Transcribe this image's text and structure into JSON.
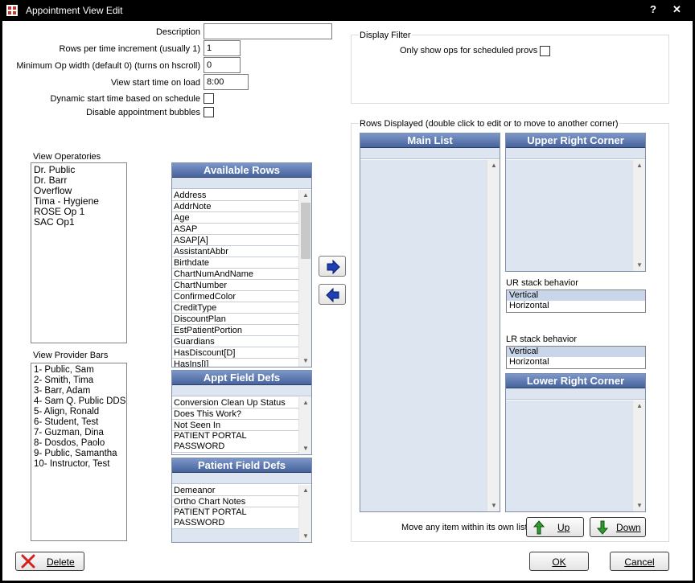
{
  "window": {
    "title": "Appointment View Edit",
    "help_label": "?",
    "close_label": "✕"
  },
  "form": {
    "description_label": "Description",
    "description_value": "",
    "rows_per_increment_label": "Rows per time increment (usually 1)",
    "rows_per_increment_value": "1",
    "min_op_width_label": "Minimum Op width (default 0) (turns on hscroll)",
    "min_op_width_value": "0",
    "view_start_time_label": "View start time on load",
    "view_start_time_value": "8:00",
    "dynamic_start_label": "Dynamic start time based on schedule",
    "disable_bubbles_label": "Disable appointment bubbles"
  },
  "display_filter": {
    "group_label": "Display Filter",
    "only_show_ops_label": "Only show ops for scheduled provs"
  },
  "operatories": {
    "label": "View Operatories",
    "items": [
      "Dr. Public",
      "Dr. Barr",
      "Overflow",
      "Tima - Hygiene",
      "ROSE Op 1",
      "SAC Op1"
    ]
  },
  "provider_bars": {
    "label": "View Provider Bars",
    "items": [
      "1- Public, Sam",
      "2- Smith, Tima",
      "3- Barr, Adam",
      "4- Sam Q. Public DDS",
      "5- Align, Ronald",
      "6- Student, Test",
      "7- Guzman, Dina",
      "8- Dosdos, Paolo",
      "9- Public, Samantha",
      "10- Instructor, Test"
    ]
  },
  "available_rows": {
    "title": "Available Rows",
    "items": [
      "Address",
      "AddrNote",
      "Age",
      "ASAP",
      "ASAP[A]",
      "AssistantAbbr",
      "Birthdate",
      "ChartNumAndName",
      "ChartNumber",
      "ConfirmedColor",
      "CreditType",
      "DiscountPlan",
      "EstPatientPortion",
      "Guardians",
      "HasDiscount[D]",
      "HasIns[I]"
    ]
  },
  "appt_field_defs": {
    "title": "Appt Field Defs",
    "items": [
      "Conversion Clean Up Status",
      "Does This Work?",
      "Not Seen In",
      "PATIENT PORTAL PASSWORD"
    ]
  },
  "patient_field_defs": {
    "title": "Patient Field Defs",
    "items": [
      "Demeanor",
      "Ortho Chart Notes",
      "PATIENT PORTAL PASSWORD"
    ]
  },
  "rows_displayed": {
    "group_label": "Rows Displayed (double click to edit or to move to another corner)",
    "main_list_title": "Main List",
    "upper_right_title": "Upper Right Corner",
    "lower_right_title": "Lower Right Corner",
    "ur_stack_label": "UR stack behavior",
    "lr_stack_label": "LR stack behavior",
    "stack_options": [
      "Vertical",
      "Horizontal"
    ],
    "move_label": "Move any item within its own list:",
    "up_label": "Up",
    "down_label": "Down"
  },
  "footer": {
    "delete_label": "Delete",
    "ok_label": "OK",
    "cancel_label": "Cancel"
  },
  "colors": {
    "grid_header_top": "#7d97c9",
    "grid_header_bottom": "#47639c",
    "arrow_blue": "#1f3fb5",
    "arrow_green": "#2e9b2e",
    "delete_red": "#d42020"
  }
}
